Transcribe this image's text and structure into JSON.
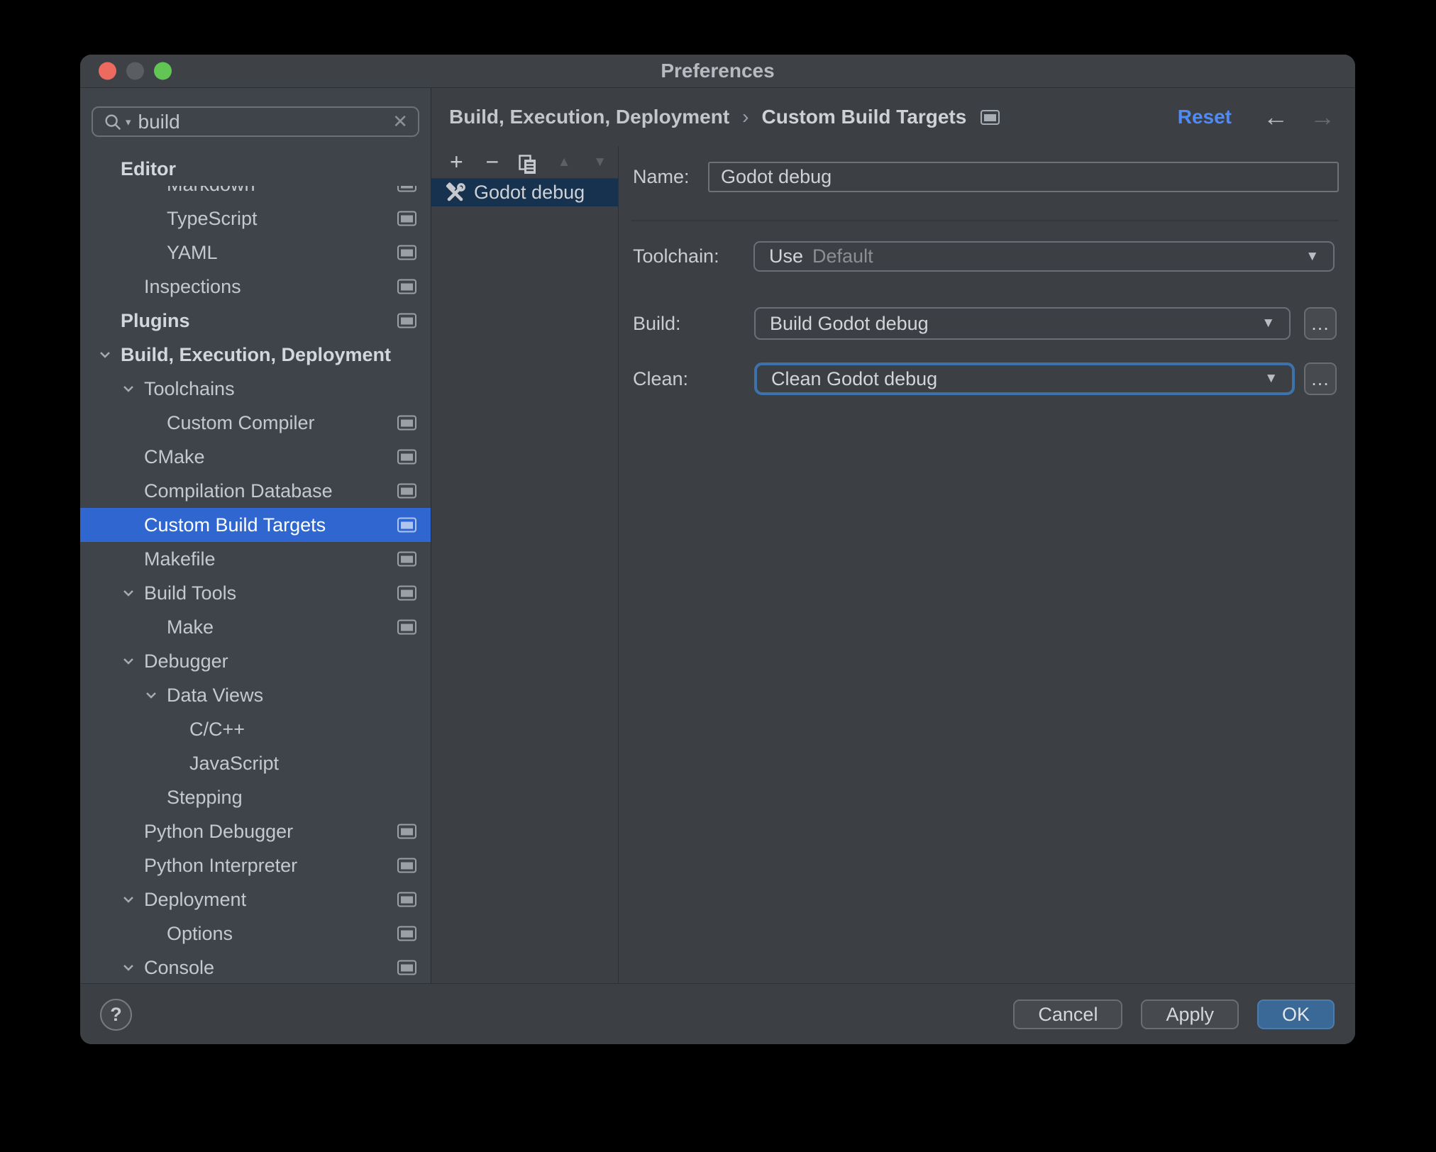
{
  "window": {
    "title": "Preferences"
  },
  "colors": {
    "selection_blue": "#2f66d0",
    "inactive_selection_navy": "#16324f",
    "focus_ring_blue": "#3e72ac",
    "ok_button_blue": "#3a6897",
    "reset_link_blue": "#4f8bf7"
  },
  "icons": {
    "search": "magnifier",
    "search_caret": "▾",
    "clear": "✕",
    "crumb_separator": "›",
    "back_arrow": "←",
    "forward_arrow": "→",
    "add": "+",
    "remove": "−",
    "move_up": "▲",
    "move_down": "▼",
    "combo_caret": "▼",
    "help": "?"
  },
  "sidebar": {
    "search": {
      "value": "build"
    },
    "tree": [
      {
        "label": "Editor"
      },
      {
        "label": "Markdown"
      },
      {
        "label": "TypeScript"
      },
      {
        "label": "YAML"
      },
      {
        "label": "Inspections"
      },
      {
        "label": "Plugins"
      },
      {
        "label": "Build, Execution, Deployment"
      },
      {
        "label": "Toolchains"
      },
      {
        "label": "Custom Compiler"
      },
      {
        "label": "CMake"
      },
      {
        "label": "Compilation Database"
      },
      {
        "label": "Custom Build Targets"
      },
      {
        "label": "Makefile"
      },
      {
        "label": "Build Tools"
      },
      {
        "label": "Make"
      },
      {
        "label": "Debugger"
      },
      {
        "label": "Data Views"
      },
      {
        "label": "C/C++"
      },
      {
        "label": "JavaScript"
      },
      {
        "label": "Stepping"
      },
      {
        "label": "Python Debugger"
      },
      {
        "label": "Python Interpreter"
      },
      {
        "label": "Deployment"
      },
      {
        "label": "Options"
      },
      {
        "label": "Console"
      }
    ]
  },
  "header": {
    "breadcrumb": [
      "Build, Execution, Deployment",
      "Custom Build Targets"
    ],
    "reset_label": "Reset"
  },
  "targets_list": {
    "items": [
      {
        "label": "Godot debug",
        "selected": true
      }
    ]
  },
  "form": {
    "name_label": "Name:",
    "name_value": "Godot debug",
    "toolchain_label": "Toolchain:",
    "toolchain_prefix": "Use",
    "toolchain_value": "Default",
    "build_label": "Build:",
    "build_value": "Build Godot debug",
    "clean_label": "Clean:",
    "clean_value": "Clean Godot debug",
    "more_label": "..."
  },
  "footer": {
    "cancel_label": "Cancel",
    "apply_label": "Apply",
    "ok_label": "OK"
  }
}
